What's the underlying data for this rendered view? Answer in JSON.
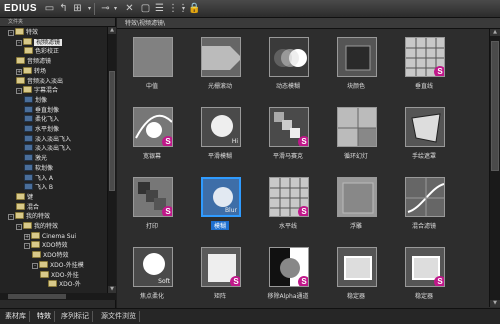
{
  "app": {
    "title": "EDIUS"
  },
  "toolbar": {
    "icons": [
      "open-folder-icon",
      "up-folder-icon",
      "new-bin-icon",
      "view-options-icon",
      "delete-icon",
      "properties-icon",
      "layout-icon",
      "lock-icon"
    ]
  },
  "left_pane": {
    "header": "文件夹",
    "tree": [
      {
        "label": "特效",
        "kind": "folder",
        "expander": "-"
      },
      {
        "label": "视频滤镜",
        "kind": "folder",
        "expander": "-",
        "selected": true
      },
      {
        "label": "色彩校正",
        "kind": "folder",
        "expander": ""
      },
      {
        "label": "音频滤镜",
        "kind": "folder",
        "expander": ""
      },
      {
        "label": "转场",
        "kind": "folder",
        "expander": "+"
      },
      {
        "label": "音频淡入淡出",
        "kind": "folder",
        "expander": ""
      },
      {
        "label": "字幕混合",
        "kind": "folder",
        "expander": "-"
      },
      {
        "label": "划像",
        "kind": "fx",
        "expander": ""
      },
      {
        "label": "垂直划像",
        "kind": "fx",
        "expander": ""
      },
      {
        "label": "柔化飞入",
        "kind": "fx",
        "expander": ""
      },
      {
        "label": "水平划像",
        "kind": "fx",
        "expander": ""
      },
      {
        "label": "淡入淡出飞入",
        "kind": "fx",
        "expander": ""
      },
      {
        "label": "淡入淡出飞入",
        "kind": "fx",
        "expander": ""
      },
      {
        "label": "激光",
        "kind": "fx",
        "expander": ""
      },
      {
        "label": "软划像",
        "kind": "fx",
        "expander": ""
      },
      {
        "label": "飞入 A",
        "kind": "fx",
        "expander": ""
      },
      {
        "label": "飞入 B",
        "kind": "fx",
        "expander": ""
      },
      {
        "label": "键",
        "kind": "folder",
        "expander": ""
      },
      {
        "label": "混合",
        "kind": "folder",
        "expander": ""
      },
      {
        "label": "我的特效",
        "kind": "folder",
        "expander": "-"
      },
      {
        "label": "我的特效",
        "kind": "folder",
        "expander": "-"
      },
      {
        "label": "Cinema Sui",
        "kind": "folder",
        "expander": "+"
      },
      {
        "label": "XDO特效",
        "kind": "folder",
        "expander": "-"
      },
      {
        "label": "XDO特效",
        "kind": "folder",
        "expander": ""
      },
      {
        "label": "XDO-外挂模",
        "kind": "folder",
        "expander": "-"
      },
      {
        "label": "XDO-外挂",
        "kind": "folder",
        "expander": ""
      },
      {
        "label": "XDO-外",
        "kind": "folder",
        "expander": ""
      }
    ]
  },
  "right_pane": {
    "path": "特效\\视频滤镜\\",
    "items": [
      {
        "label": "中值",
        "style": "noise",
        "badge": false
      },
      {
        "label": "光栅滚动",
        "style": "wave",
        "badge": false
      },
      {
        "label": "动态模糊",
        "style": "motion",
        "badge": false
      },
      {
        "label": "块颜色",
        "style": "block",
        "badge": false
      },
      {
        "label": "垂直线",
        "style": "grid",
        "badge": true
      },
      {
        "label": "宽银幕",
        "style": "curve",
        "badge": true
      },
      {
        "label": "平滑模糊",
        "style": "smooth",
        "badge": false,
        "text": "Hi"
      },
      {
        "label": "平滑马赛克",
        "style": "mosaic",
        "badge": true
      },
      {
        "label": "循环幻灯",
        "style": "quad",
        "badge": false
      },
      {
        "label": "手绘遮罩",
        "style": "mask",
        "badge": false
      },
      {
        "label": "打印",
        "style": "print",
        "badge": true
      },
      {
        "label": "模糊",
        "style": "blur",
        "badge": false,
        "text": "Blur",
        "selected": true
      },
      {
        "label": "水平线",
        "style": "grid",
        "badge": true
      },
      {
        "label": "浮雕",
        "style": "emboss",
        "badge": false
      },
      {
        "label": "混合滤镜",
        "style": "mix",
        "badge": false
      },
      {
        "label": "焦点柔化",
        "style": "soft",
        "badge": false,
        "text": "Soft"
      },
      {
        "label": "矩阵",
        "style": "matrix",
        "badge": true
      },
      {
        "label": "移除Alpha通道",
        "style": "alpha",
        "badge": true
      },
      {
        "label": "稳定器",
        "style": "stab",
        "badge": false
      },
      {
        "label": "稳定器",
        "style": "stab",
        "badge": true
      }
    ]
  },
  "bottom_tabs": [
    "素材库",
    "特效",
    "序列标记",
    "源文件浏览"
  ],
  "colors": {
    "accent": "#2f9bff",
    "badge": "#c0188a"
  }
}
